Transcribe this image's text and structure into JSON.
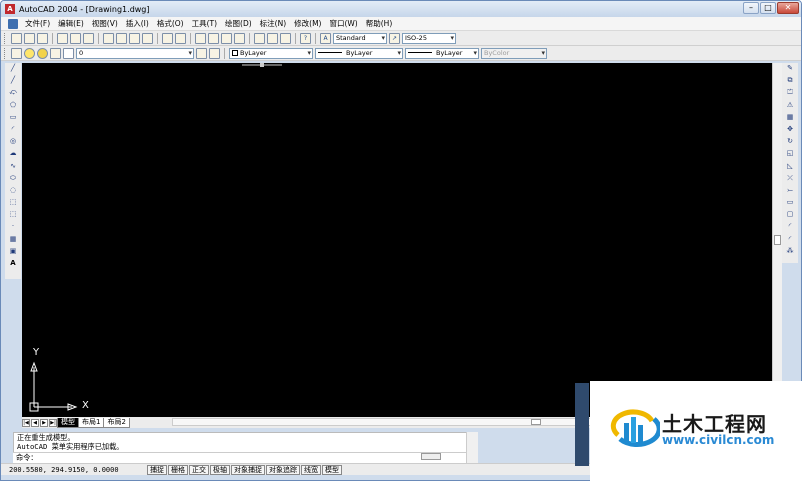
{
  "window": {
    "title": "AutoCAD 2004 - [Drawing1.dwg]",
    "minimize": "–",
    "maximize": "□",
    "close": "✕"
  },
  "menu": {
    "items": [
      "文件(F)",
      "编辑(E)",
      "视图(V)",
      "插入(I)",
      "格式(O)",
      "工具(T)",
      "绘图(D)",
      "标注(N)",
      "修改(M)",
      "窗口(W)",
      "帮助(H)"
    ],
    "mdi": [
      "–",
      "❐",
      "✕"
    ]
  },
  "toolbar": {
    "text_style": "Standard",
    "dim_style": "ISO-25"
  },
  "properties": {
    "layer": "0",
    "color": "ByLayer",
    "linetype": "ByLayer",
    "lineweight": "ByLayer",
    "plot_style": "ByColor"
  },
  "left_tools": [
    "╱",
    "╱",
    "⤽",
    "⬠",
    "▭",
    "◜",
    "◎",
    "☁",
    "∿",
    "⬭",
    "◌",
    "⬚",
    "⬚",
    "·",
    "▦",
    "▣",
    "A"
  ],
  "right_tools": [
    "✎",
    "⧉",
    "⏍",
    "⚠",
    "▦",
    "✥",
    "↻",
    "◱",
    "◺",
    "⤫",
    "⤚",
    "▭",
    "▢",
    "◜",
    "◜",
    "⁂"
  ],
  "ucs": {
    "y": "Y",
    "x": "X"
  },
  "tabs": {
    "nav": [
      "|◀",
      "◀",
      "▶",
      "▶|"
    ],
    "model": "模型",
    "layout1": "布局1",
    "layout2": "布局2"
  },
  "command": {
    "history": [
      "正在重生成模型。",
      "AutoCAD 菜单实用程序已加载。"
    ],
    "prompt": "命令："
  },
  "status": {
    "coords": "200.5580, 294.9150, 0.0000",
    "buttons": [
      "捕捉",
      "栅格",
      "正交",
      "极轴",
      "对象捕捉",
      "对象追踪",
      "线宽",
      "模型"
    ]
  },
  "watermark": {
    "name": "土木工程网",
    "url": "www.civilcn.com"
  }
}
